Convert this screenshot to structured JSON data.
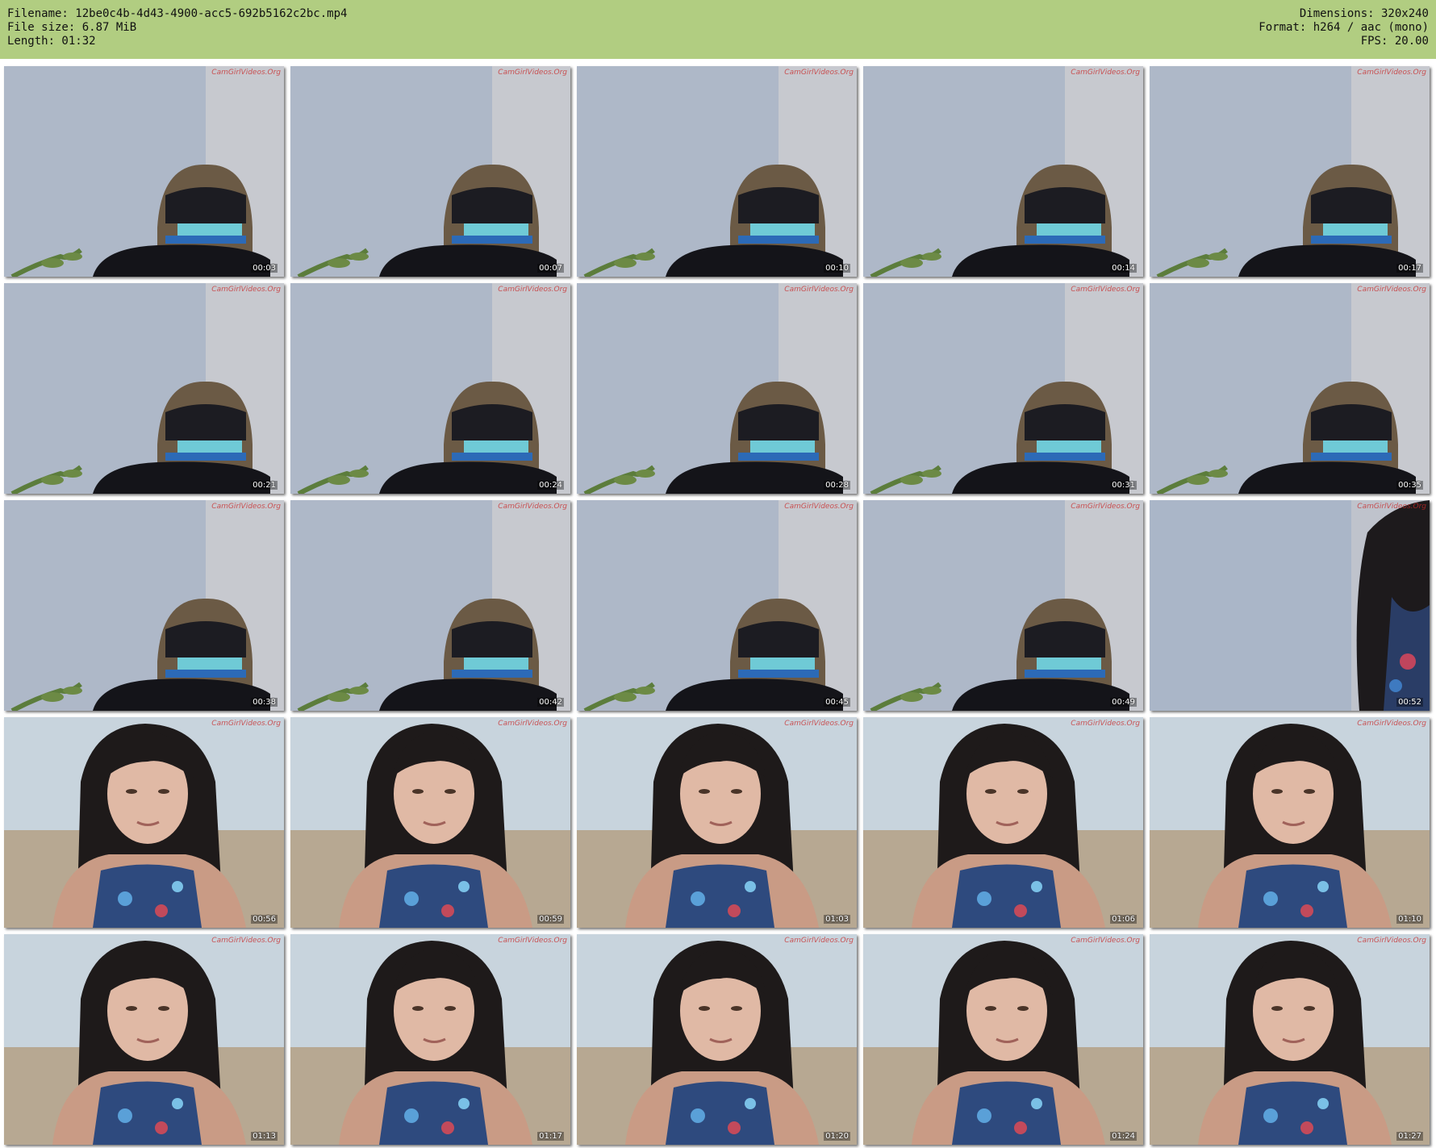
{
  "header": {
    "filename": "Filename: 12be0c4b-4d43-4900-acc5-692b5162c2bc.mp4",
    "filesize": "File size: 6.87 MiB",
    "length": "Length: 01:32",
    "dimensions": "Dimensions: 320x240",
    "format": "Format: h264 / aac (mono)",
    "fps": "FPS: 20.00"
  },
  "colors": {
    "header_bg": "#b1cd81",
    "wall": "#b6c0ce",
    "chair": "#6b5a45"
  },
  "thumbnails": [
    {
      "time": "00:03",
      "scene": "room"
    },
    {
      "time": "00:07",
      "scene": "room"
    },
    {
      "time": "00:10",
      "scene": "room"
    },
    {
      "time": "00:14",
      "scene": "room"
    },
    {
      "time": "00:17",
      "scene": "room"
    },
    {
      "time": "00:21",
      "scene": "room"
    },
    {
      "time": "00:24",
      "scene": "room"
    },
    {
      "time": "00:28",
      "scene": "room"
    },
    {
      "time": "00:31",
      "scene": "room"
    },
    {
      "time": "00:35",
      "scene": "room"
    },
    {
      "time": "00:38",
      "scene": "room"
    },
    {
      "time": "00:42",
      "scene": "room"
    },
    {
      "time": "00:45",
      "scene": "room"
    },
    {
      "time": "00:49",
      "scene": "room"
    },
    {
      "time": "00:52",
      "scene": "enter"
    },
    {
      "time": "00:56",
      "scene": "person"
    },
    {
      "time": "00:59",
      "scene": "person"
    },
    {
      "time": "01:03",
      "scene": "person"
    },
    {
      "time": "01:06",
      "scene": "person"
    },
    {
      "time": "01:10",
      "scene": "person"
    },
    {
      "time": "01:13",
      "scene": "person"
    },
    {
      "time": "01:17",
      "scene": "person"
    },
    {
      "time": "01:20",
      "scene": "person"
    },
    {
      "time": "01:24",
      "scene": "person"
    },
    {
      "time": "01:27",
      "scene": "person"
    }
  ],
  "watermark": "CamGirlVideos.Org"
}
